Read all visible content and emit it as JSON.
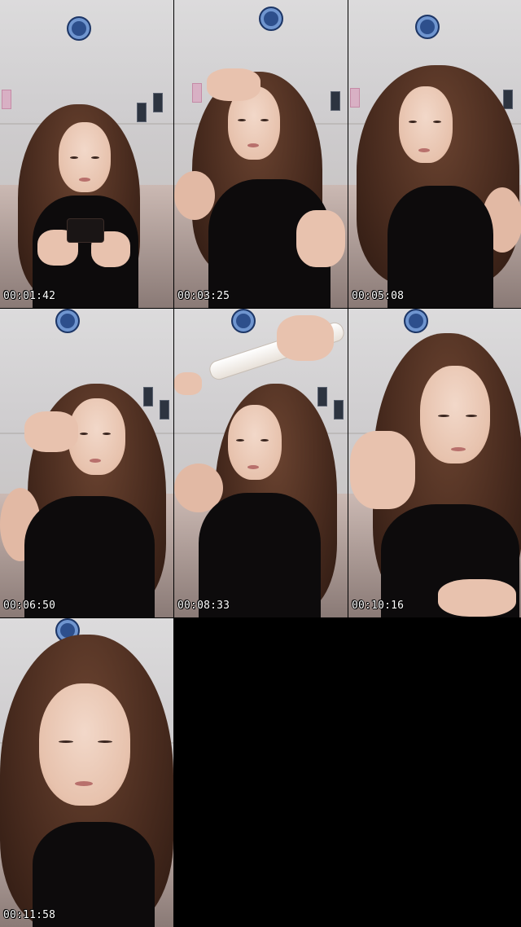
{
  "contact_sheet": {
    "columns": 3,
    "rows": 3,
    "background_color": "#000000",
    "timestamp_color": "#ffffff",
    "frames": [
      {
        "timestamp": "00:01:42"
      },
      {
        "timestamp": "00:03:25"
      },
      {
        "timestamp": "00:05:08"
      },
      {
        "timestamp": "00:06:50"
      },
      {
        "timestamp": "00:08:33"
      },
      {
        "timestamp": "00:10:16"
      },
      {
        "timestamp": "00:11:58"
      }
    ]
  }
}
